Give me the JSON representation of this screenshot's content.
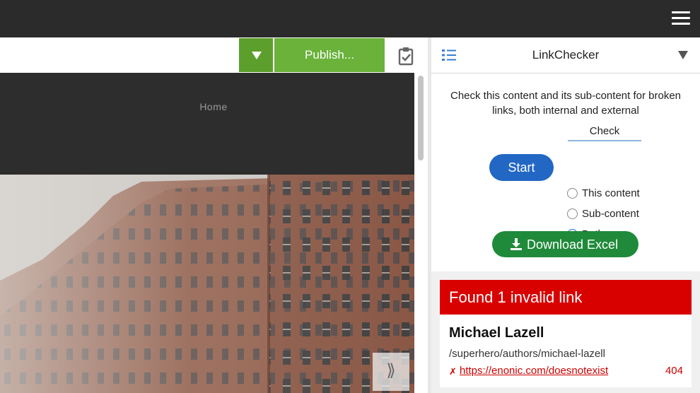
{
  "app": {
    "menu_icon": "hamburger-icon"
  },
  "toolbar": {
    "publish_label": "Publish...",
    "dropdown_icon": "triangle-down-icon",
    "checklist_icon": "clipboard-check-icon"
  },
  "preview": {
    "home_link": "Home",
    "expand_icon": "double-chevron-right-icon"
  },
  "panel": {
    "title": "LinkChecker",
    "list_icon": "list-icon",
    "description": "Check this content and its sub-content for broken links, both internal and external",
    "start_label": "Start",
    "check_label": "Check",
    "options": [
      {
        "label": "This content",
        "selected": false
      },
      {
        "label": "Sub-content",
        "selected": false
      },
      {
        "label": "Both",
        "selected": true
      }
    ],
    "download_label": "Download Excel",
    "download_icon": "download-icon"
  },
  "results": {
    "header": "Found 1 invalid link",
    "items": [
      {
        "name": "Michael Lazell",
        "path": "/superhero/authors/michael-lazell",
        "error_mark": "✗",
        "url": "https://enonic.com/doesnotexist",
        "status": "404"
      }
    ]
  },
  "colors": {
    "topbar": "#2b2b2b",
    "publish_green": "#6ab23a",
    "start_blue": "#2267c4",
    "download_green": "#1f8a3a",
    "error_red": "#d90000"
  }
}
